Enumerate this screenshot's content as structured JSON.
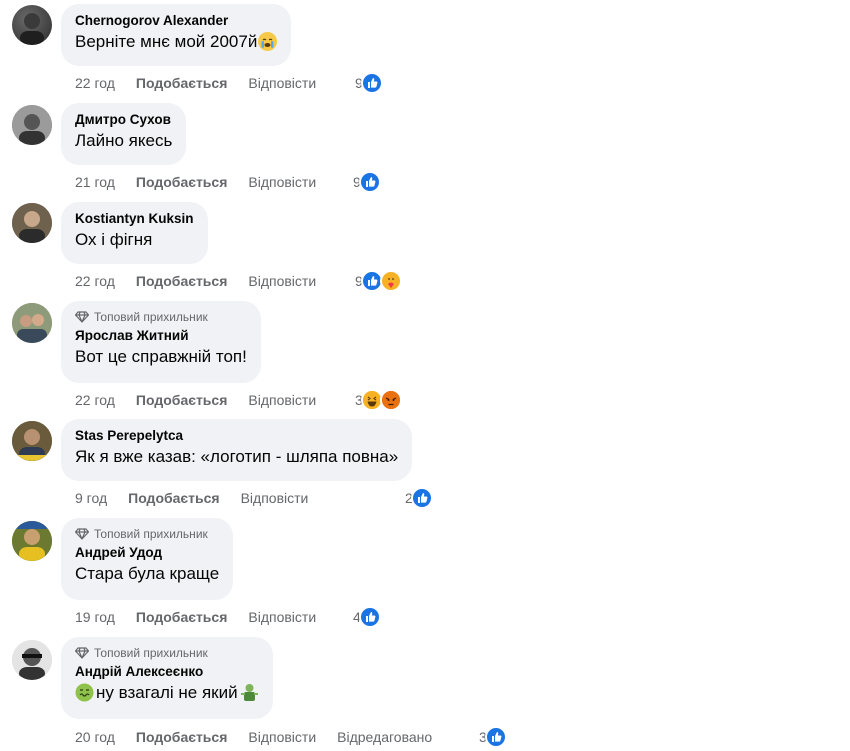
{
  "labels": {
    "like": "Подобається",
    "reply": "Відповісти",
    "edited": "Відредаговано",
    "top_fan": "Топовий прихильник"
  },
  "comments": [
    {
      "author": "Chernogorov Alexander",
      "text": "Верніте мнє мой 2007й",
      "time": "22 год",
      "count": "9",
      "reactions": [
        "like"
      ],
      "top_fan": false,
      "text_emoji": "crying-face-icon"
    },
    {
      "author": "Дмитро Сухов",
      "text": "Лайно якесь",
      "time": "21 год",
      "count": "9",
      "reactions": [
        "like"
      ],
      "top_fan": false
    },
    {
      "author": "Kostiantyn Kuksin",
      "text": "Ох і фігня",
      "time": "22 год",
      "count": "9",
      "reactions": [
        "like",
        "care"
      ],
      "top_fan": false
    },
    {
      "author": "Ярослав Житний",
      "text": "Вот це справжній топ!",
      "time": "22 год",
      "count": "3",
      "reactions": [
        "haha",
        "angry"
      ],
      "top_fan": true
    },
    {
      "author": "Stas Perepelytca",
      "text": "Як я вже казав: «логотип - шляпа повна»",
      "time": "9 год",
      "count": "2",
      "reactions": [
        "like"
      ],
      "top_fan": false
    },
    {
      "author": "Андрей Удод",
      "text": "Стара була краще",
      "time": "19 год",
      "count": "4",
      "reactions": [
        "like"
      ],
      "top_fan": true
    },
    {
      "author": "Андрій Алексеєнко",
      "text": "ну взагалі не який",
      "time": "20 год",
      "count": "3",
      "reactions": [
        "like"
      ],
      "top_fan": true,
      "edited": true
    }
  ],
  "colors": {
    "like": "#1b74e4",
    "bubble": "#f0f2f5",
    "muted": "#65676b"
  }
}
